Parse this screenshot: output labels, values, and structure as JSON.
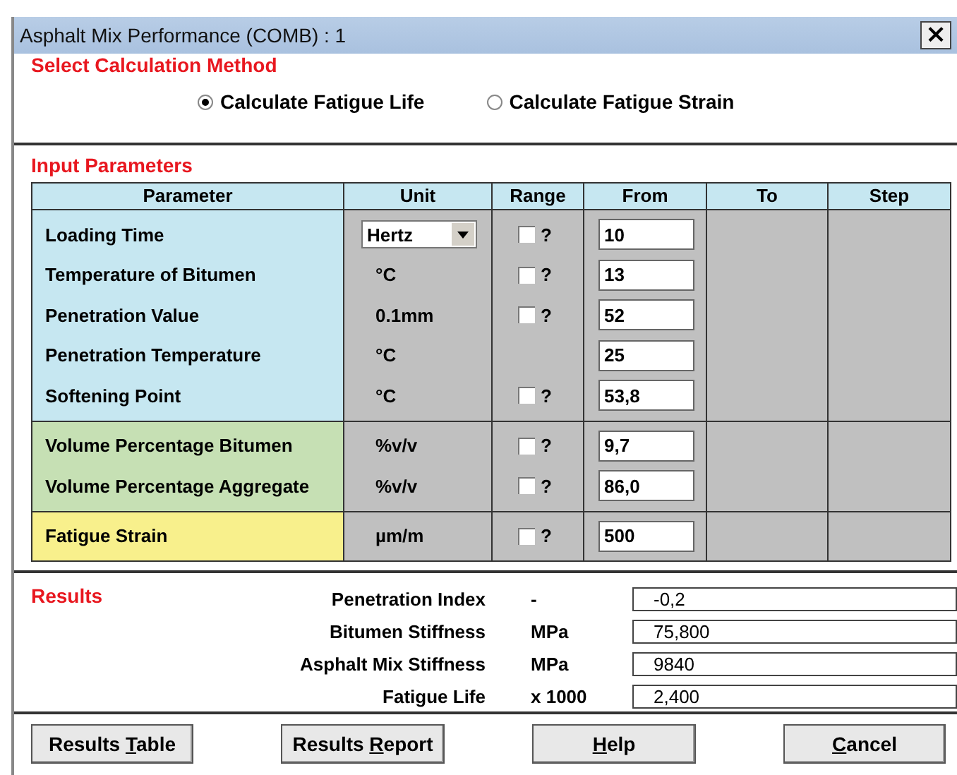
{
  "window": {
    "title": "Asphalt Mix Performance (COMB) : 1",
    "close": "×"
  },
  "method": {
    "heading": "Select Calculation Method",
    "options": [
      {
        "label": "Calculate Fatigue Life",
        "selected": true
      },
      {
        "label": "Calculate Fatigue Strain",
        "selected": false
      }
    ]
  },
  "inputs": {
    "heading": "Input Parameters",
    "columns": [
      "Parameter",
      "Unit",
      "Range",
      "From",
      "To",
      "Step"
    ],
    "groups": [
      {
        "color": "#c6e7f1",
        "rows": [
          {
            "parameter": "Loading Time",
            "unit": "Hertz",
            "kind": "dropdown",
            "range": {
              "checked": false,
              "label": "?"
            },
            "from": "10"
          },
          {
            "parameter": "Temperature of Bitumen",
            "unit": "°C",
            "kind": "text",
            "range": {
              "checked": false,
              "label": "?"
            },
            "from": "13"
          },
          {
            "parameter": "Penetration Value",
            "unit": "0.1mm",
            "kind": "text",
            "range": {
              "checked": false,
              "label": "?"
            },
            "from": "52"
          },
          {
            "parameter": "Penetration Temperature",
            "unit": "°C",
            "kind": "text",
            "from": "25"
          },
          {
            "parameter": "Softening Point",
            "unit": "°C",
            "kind": "text",
            "range": {
              "checked": false,
              "label": "?"
            },
            "from": "53,8"
          }
        ]
      },
      {
        "color": "#c6e0b4",
        "rows": [
          {
            "parameter": "Volume Percentage Bitumen",
            "unit": "%v/v",
            "kind": "text",
            "range": {
              "checked": false,
              "label": "?"
            },
            "from": "9,7"
          },
          {
            "parameter": "Volume Percentage Aggregate",
            "unit": "%v/v",
            "kind": "text",
            "range": {
              "checked": false,
              "label": "?"
            },
            "from": "86,0"
          }
        ]
      },
      {
        "color": "#f8f08c",
        "rows": [
          {
            "parameter": "Fatigue Strain",
            "unit": "µm/m",
            "kind": "text",
            "range": {
              "checked": false,
              "label": "?"
            },
            "from": "500"
          }
        ]
      }
    ]
  },
  "results": {
    "heading": "Results",
    "rows": [
      {
        "label": "Penetration Index",
        "unit": "-",
        "value": "-0,2"
      },
      {
        "label": "Bitumen Stiffness",
        "unit": "MPa",
        "value": "75,800"
      },
      {
        "label": "Asphalt Mix Stiffness",
        "unit": "MPa",
        "value": "9840"
      },
      {
        "label": "Fatigue Life",
        "unit": "x 1000",
        "value": "2,400"
      }
    ]
  },
  "buttons": [
    {
      "before": "Results ",
      "key": "T",
      "after": "able"
    },
    {
      "before": "Results ",
      "key": "R",
      "after": "eport"
    },
    {
      "key": "H",
      "after": "elp"
    },
    {
      "key": "C",
      "after": "ancel"
    }
  ]
}
